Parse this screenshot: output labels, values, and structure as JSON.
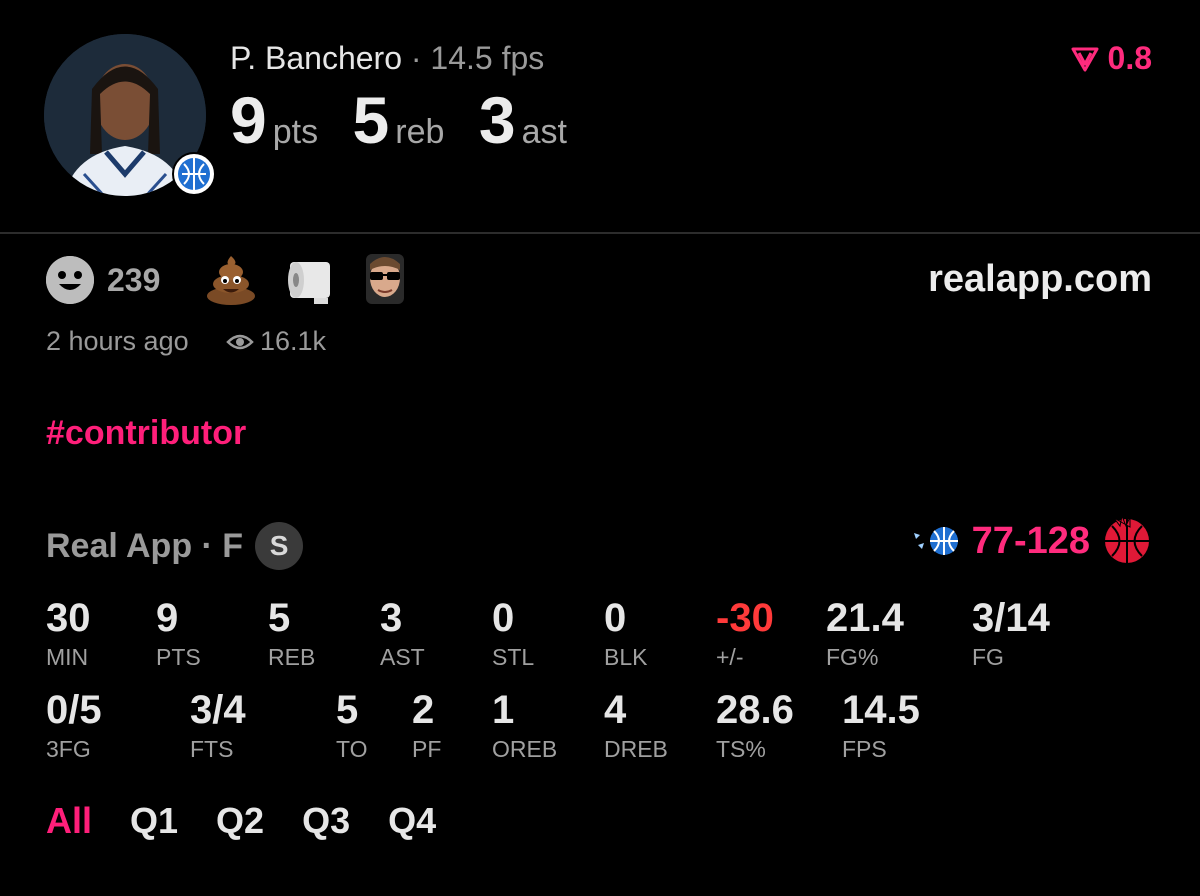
{
  "player": {
    "name": "P. Banchero",
    "separator": "·",
    "fps_text": "14.5 fps",
    "big_stats": [
      {
        "value": "9",
        "label": "pts"
      },
      {
        "value": "5",
        "label": "reb"
      },
      {
        "value": "3",
        "label": "ast"
      }
    ]
  },
  "rating": {
    "value": "0.8",
    "color": "#ff2b7d"
  },
  "reactions": {
    "count": "239",
    "emojis": [
      "poop-emoji",
      "toilet-paper-emoji",
      "sunglasses-face-emoji"
    ]
  },
  "site": "realapp.com",
  "time_ago": "2 hours ago",
  "views": "16.1k",
  "hashtag": "#contributor",
  "game": {
    "league": "Real App · F",
    "badge": "S",
    "score": "77-128"
  },
  "stats": [
    {
      "value": "30",
      "label": "MIN"
    },
    {
      "value": "9",
      "label": "PTS"
    },
    {
      "value": "5",
      "label": "REB"
    },
    {
      "value": "3",
      "label": "AST"
    },
    {
      "value": "0",
      "label": "STL"
    },
    {
      "value": "0",
      "label": "BLK"
    },
    {
      "value": "-30",
      "label": "+/-"
    },
    {
      "value": "21.4",
      "label": "FG%"
    },
    {
      "value": "3/14",
      "label": "FG"
    },
    {
      "value": "0/5",
      "label": "3FG"
    },
    {
      "value": "3/4",
      "label": "FTS"
    },
    {
      "value": "5",
      "label": "TO"
    },
    {
      "value": "2",
      "label": "PF"
    },
    {
      "value": "1",
      "label": "OREB"
    },
    {
      "value": "4",
      "label": "DREB"
    },
    {
      "value": "28.6",
      "label": "TS%"
    },
    {
      "value": "14.5",
      "label": "FPS"
    }
  ],
  "tabs": [
    "All",
    "Q1",
    "Q2",
    "Q3",
    "Q4"
  ],
  "active_tab": "All",
  "colors": {
    "accent": "#ff1f7a",
    "negative": "#ff3a3a"
  }
}
